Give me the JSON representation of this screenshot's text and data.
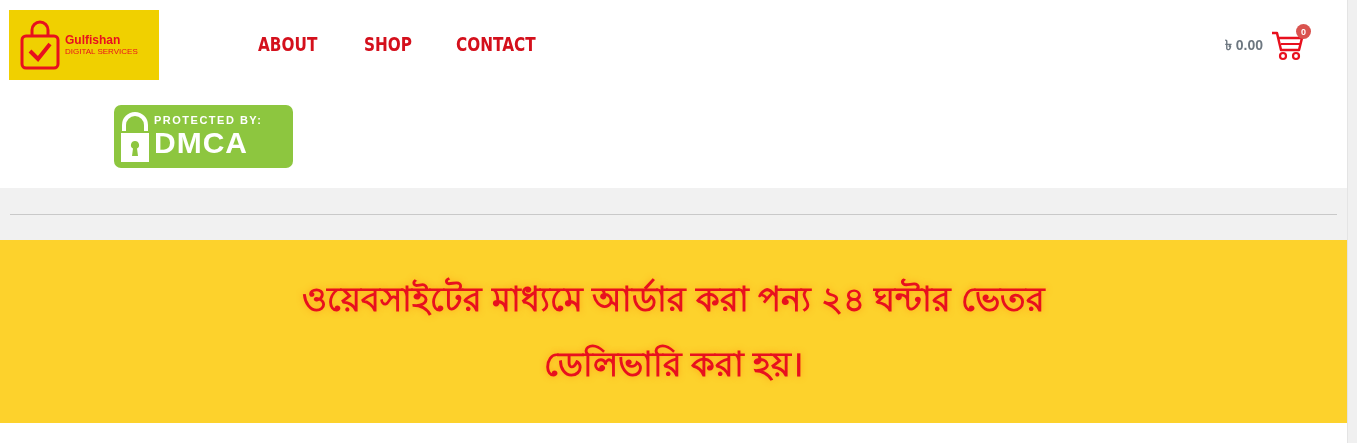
{
  "logo": {
    "name": "Gulfishan",
    "tagline": "DIGITAL SERVICES"
  },
  "nav": [
    {
      "label": "ABOUT"
    },
    {
      "label": "SHOP"
    },
    {
      "label": "CONTACT"
    }
  ],
  "cart": {
    "total": "৳ 0.00",
    "count": "0"
  },
  "badge": {
    "top": "PROTECTED BY:",
    "main": "DMCA"
  },
  "banner": {
    "text": "ওয়েবসাইটের মাধ্যমে আর্ডার করা পন্য ২৪ ঘন্টার ভেতর ডেলিভারি করা হয়।"
  }
}
